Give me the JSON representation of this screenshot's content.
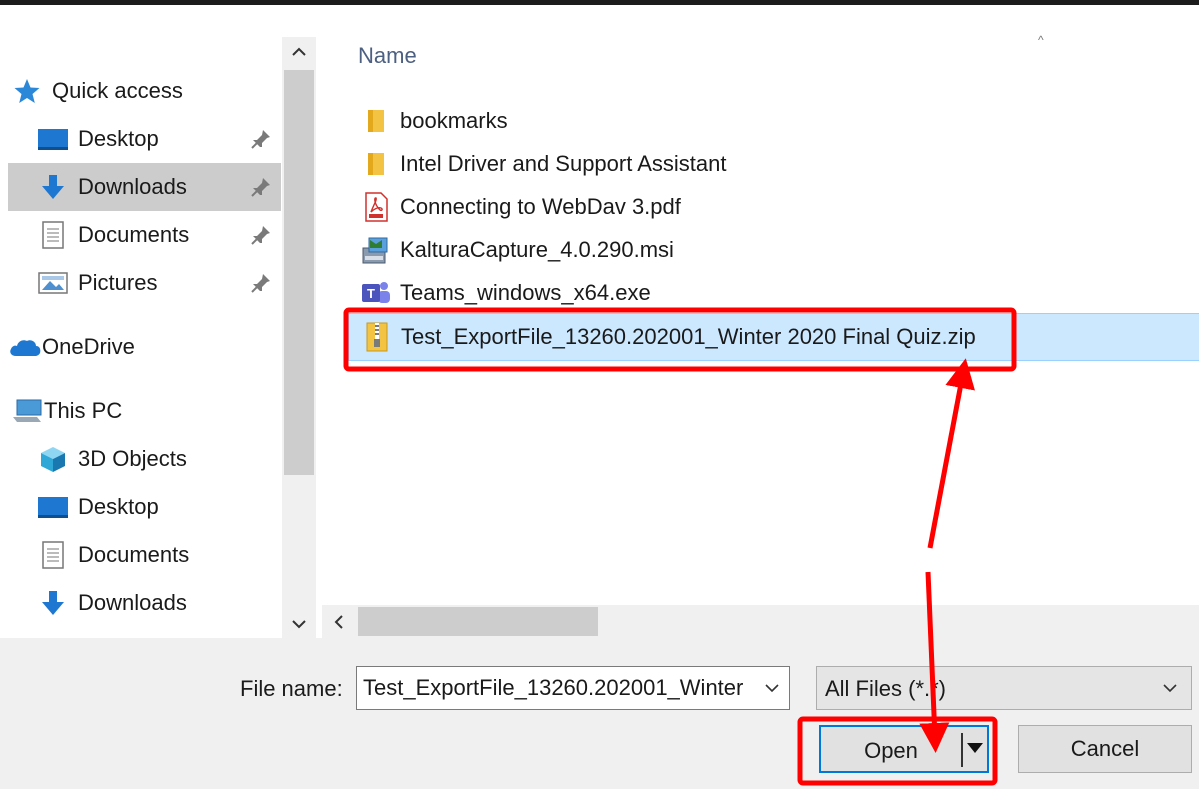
{
  "nav": {
    "items": [
      {
        "label": "Quick access",
        "icon": "star-icon"
      },
      {
        "label": "Desktop",
        "icon": "desktop-icon",
        "pinned": true
      },
      {
        "label": "Downloads",
        "icon": "download-arrow-icon",
        "pinned": true,
        "selected": true
      },
      {
        "label": "Documents",
        "icon": "document-icon",
        "pinned": true
      },
      {
        "label": "Pictures",
        "icon": "pictures-icon",
        "pinned": true
      },
      {
        "label": "OneDrive",
        "icon": "cloud-icon"
      },
      {
        "label": "This PC",
        "icon": "computer-icon"
      },
      {
        "label": "3D Objects",
        "icon": "cube-icon"
      },
      {
        "label": "Desktop",
        "icon": "desktop-icon"
      },
      {
        "label": "Documents",
        "icon": "document-icon"
      },
      {
        "label": "Downloads",
        "icon": "download-arrow-icon"
      }
    ]
  },
  "files": {
    "column_header": "Name",
    "items": [
      {
        "name": "bookmarks",
        "icon": "folder-icon"
      },
      {
        "name": "Intel Driver and Support Assistant",
        "icon": "folder-icon"
      },
      {
        "name": "Connecting to WebDav 3.pdf",
        "icon": "pdf-icon"
      },
      {
        "name": "KalturaCapture_4.0.290.msi",
        "icon": "installer-icon"
      },
      {
        "name": "Teams_windows_x64.exe",
        "icon": "teams-icon"
      },
      {
        "name": "Test_ExportFile_13260.202001_Winter 2020 Final Quiz.zip",
        "icon": "zip-icon",
        "selected": true
      }
    ]
  },
  "bottom": {
    "file_name_label": "File name:",
    "file_name_value": "Test_ExportFile_13260.202001_Winter",
    "file_type_value": "All Files (*.*)",
    "open_label": "Open",
    "cancel_label": "Cancel"
  },
  "colors": {
    "selection_bg": "#cce8ff",
    "nav_selected_bg": "#cccccc",
    "annotation_red": "#ff0000",
    "accent": "#0078d7"
  }
}
